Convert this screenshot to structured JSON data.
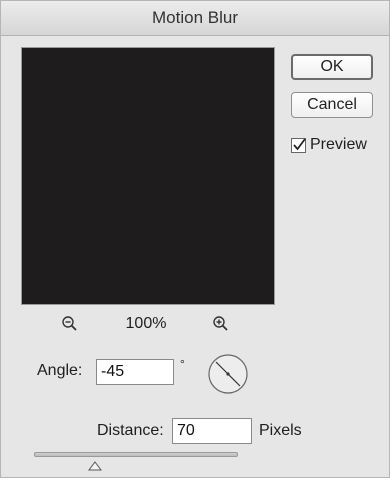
{
  "dialog": {
    "title": "Motion Blur"
  },
  "buttons": {
    "ok_label": "OK",
    "cancel_label": "Cancel"
  },
  "preview_option": {
    "label": "Preview",
    "checked": true
  },
  "zoom": {
    "level": "100%",
    "zoom_out_icon": "zoom-out-magnifier",
    "zoom_in_icon": "zoom-in-magnifier"
  },
  "angle": {
    "label": "Angle:",
    "value": "-45",
    "unit": "°",
    "dial_icon": "angle-dial"
  },
  "distance": {
    "label": "Distance:",
    "value": "70",
    "unit": "Pixels",
    "slider_fraction": 0.3
  },
  "colors": {
    "dialog_bg": "#e6e6e6",
    "preview_bg": "#1f1c1d"
  }
}
